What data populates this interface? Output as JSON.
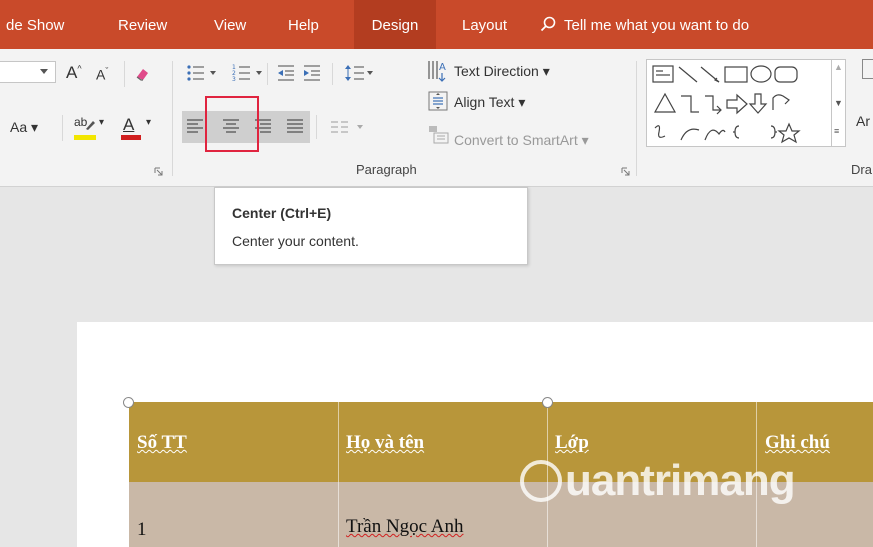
{
  "tabs": [
    {
      "label": "de Show"
    },
    {
      "label": "Review"
    },
    {
      "label": "View"
    },
    {
      "label": "Help"
    },
    {
      "label": "Design"
    },
    {
      "label": "Layout"
    }
  ],
  "tell_me": {
    "label": "Tell me what you want to do",
    "icon": "search-icon"
  },
  "ribbon": {
    "font": {
      "change_case": "Aa",
      "grow_icon": "grow-font-icon",
      "shrink_icon": "shrink-font-icon",
      "clear_icon": "clear-formatting-icon",
      "highlight_color": "#f2e600",
      "font_color": "#d11f1f"
    },
    "paragraph": {
      "label": "Paragraph",
      "text_direction": "Text Direction",
      "align_text": "Align Text",
      "convert_smartart": "Convert to SmartArt"
    },
    "drawing": {
      "label_partial": "Dra",
      "arrange_partial": "Ar"
    }
  },
  "tooltip": {
    "title": "Center (Ctrl+E)",
    "description": "Center your content."
  },
  "table": {
    "headers": [
      "Số TT",
      "Họ và tên",
      "Lớp",
      "Ghi chú"
    ],
    "row1": [
      "1",
      "Trần Ngọc Anh"
    ],
    "header_color": "#b8963a",
    "row_color": "#c9b8a7"
  },
  "watermark": {
    "text": "uantrimang"
  },
  "colors": {
    "tab_bar": "#c94a2a",
    "active_tab": "#b33d20",
    "highlight_box": "#e0243f"
  }
}
